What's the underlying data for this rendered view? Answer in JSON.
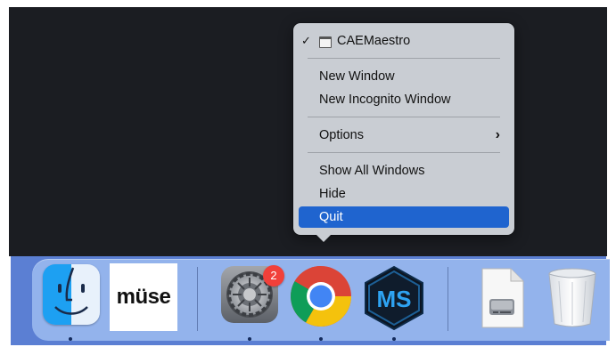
{
  "context_menu": {
    "app_name": "CAEMaestro",
    "checkmark": "✓",
    "items": {
      "new_window": "New Window",
      "new_incognito_window": "New Incognito Window",
      "options": "Options",
      "show_all_windows": "Show All Windows",
      "hide": "Hide",
      "quit": "Quit"
    },
    "submenu_chevron": "›",
    "highlighted_item": "Quit"
  },
  "dock": {
    "apps": [
      {
        "name": "Finder",
        "icon": "finder-icon",
        "running": true
      },
      {
        "name": "Muse",
        "label": "müse",
        "icon": "muse-icon",
        "running": false
      },
      {
        "name": "System Preferences",
        "icon": "gear-icon",
        "badge": "2",
        "running": true
      },
      {
        "name": "Chrome",
        "icon": "chrome-icon",
        "running": true
      },
      {
        "name": "CAEMaestro",
        "label": "MS",
        "icon": "ms-hexagon-icon",
        "running": true
      },
      {
        "name": "Disk Image",
        "icon": "disk-image-file-icon",
        "running": false
      },
      {
        "name": "Trash",
        "icon": "trash-icon",
        "running": false
      }
    ]
  },
  "colors": {
    "desktop": "#1b1d22",
    "menu_bg": "#c9cdd3",
    "highlight": "#1f64cf",
    "dock": "#93b3ec",
    "badge": "#f1403a"
  }
}
